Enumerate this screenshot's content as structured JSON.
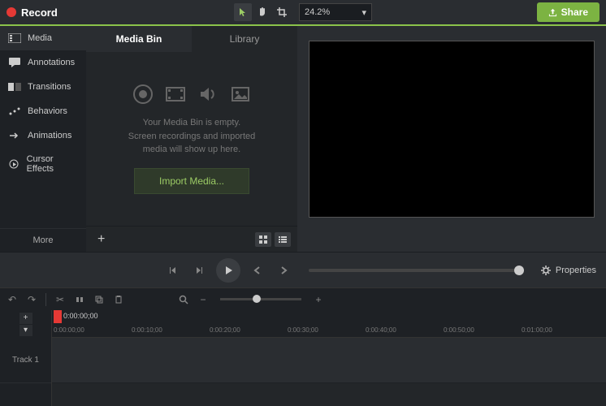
{
  "topbar": {
    "record_label": "Record",
    "zoom_value": "24.2%",
    "share_label": "Share"
  },
  "sidebar": {
    "items": [
      {
        "label": "Media"
      },
      {
        "label": "Annotations"
      },
      {
        "label": "Transitions"
      },
      {
        "label": "Behaviors"
      },
      {
        "label": "Animations"
      },
      {
        "label": "Cursor Effects"
      }
    ],
    "more_label": "More"
  },
  "mediabin": {
    "tabs": [
      {
        "label": "Media Bin"
      },
      {
        "label": "Library"
      }
    ],
    "empty_line1": "Your Media Bin is empty.",
    "empty_line2": "Screen recordings and imported",
    "empty_line3": "media will show up here.",
    "import_label": "Import Media..."
  },
  "playback": {
    "properties_label": "Properties"
  },
  "timeline": {
    "current_tc": "0:00:00;00",
    "track1_label": "Track 1",
    "ticks": [
      "0:00:00;00",
      "0:00:10;00",
      "0:00:20;00",
      "0:00:30;00",
      "0:00:40;00",
      "0:00:50;00",
      "0:01:00;00"
    ]
  }
}
